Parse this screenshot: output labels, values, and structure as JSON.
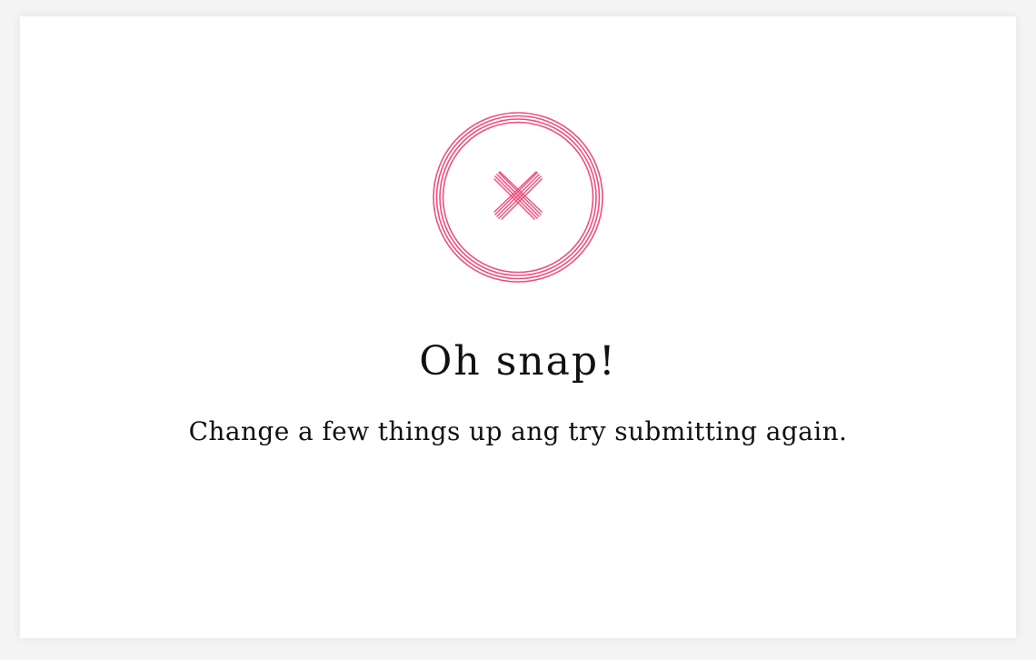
{
  "dialog": {
    "icon": "error-x-circle-icon",
    "accent_color": "#ef4f7c",
    "title": "Oh snap!",
    "message": "Change a few things up ang try submitting again."
  }
}
